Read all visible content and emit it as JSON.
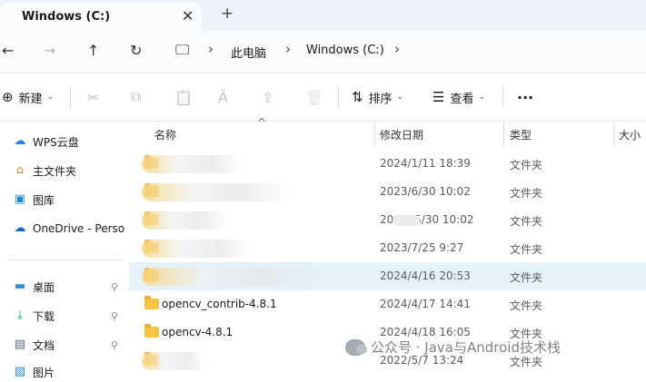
{
  "tab": {
    "title": "Windows (C:)",
    "close_glyph": "✕",
    "add_glyph": "+"
  },
  "address": {
    "back_glyph": "←",
    "forward_glyph": "→",
    "up_glyph": "↑",
    "refresh_glyph": "↻",
    "computer_glyph": "🖵",
    "separator_glyph": "›",
    "breadcrumbs": [
      "此电脑",
      "Windows (C:)"
    ]
  },
  "toolbar": {
    "new_label": "新建",
    "sort_label": "排序",
    "view_label": "查看",
    "more_label": "···",
    "cut_glyph": "✂",
    "copy_glyph": "⧉",
    "paste_glyph": "📋",
    "rename_glyph": "Ā",
    "share_glyph": "⇪",
    "delete_glyph": "🗑",
    "chevron_glyph": "⌄"
  },
  "sidebar": {
    "items": [
      {
        "label": "WPS云盘",
        "icon": "cloud-icon"
      },
      {
        "label": "主文件夹",
        "icon": "home-icon"
      },
      {
        "label": "图库",
        "icon": "gallery-icon"
      },
      {
        "label": "OneDrive - Perso",
        "icon": "onedrive-icon"
      }
    ],
    "pinned": [
      {
        "label": "桌面",
        "icon": "desktop-icon"
      },
      {
        "label": "下载",
        "icon": "download-icon"
      },
      {
        "label": "文档",
        "icon": "documents-icon"
      },
      {
        "label": "图片",
        "icon": "pictures-icon"
      }
    ],
    "pin_glyph": "📌"
  },
  "columns": {
    "name": "名称",
    "date": "修改日期",
    "type": "类型",
    "size": "大小",
    "sort_caret": "^"
  },
  "rows": [
    {
      "name": "",
      "date": "2024/1/11 18:39",
      "type": "文件夹",
      "blurred": true
    },
    {
      "name": "",
      "date": "2023/6/30 10:02",
      "type": "文件夹",
      "blurred": true
    },
    {
      "name": "",
      "date": "20      5/30 10:02",
      "type": "文件夹",
      "blurred": true
    },
    {
      "name": "",
      "date": "2023/7/25 9:27",
      "type": "文件夹",
      "blurred": true
    },
    {
      "name": "",
      "date": "2024/4/16 20:53",
      "type": "文件夹",
      "blurred": true,
      "selected": true
    },
    {
      "name": "opencv_contrib-4.8.1",
      "date": "2024/4/17 14:41",
      "type": "文件夹"
    },
    {
      "name": "opencv-4.8.1",
      "date": "2024/4/18 16:05",
      "type": "文件夹"
    },
    {
      "name": "",
      "date": "2022/5/7 13:24",
      "type": "文件夹",
      "blurred": true
    }
  ],
  "watermark": {
    "text": "公众号 · Java与Android技术栈"
  },
  "colors": {
    "selection": "#e5f1fb",
    "folder": "#f6c342",
    "tabstrip": "#eef3f9"
  }
}
